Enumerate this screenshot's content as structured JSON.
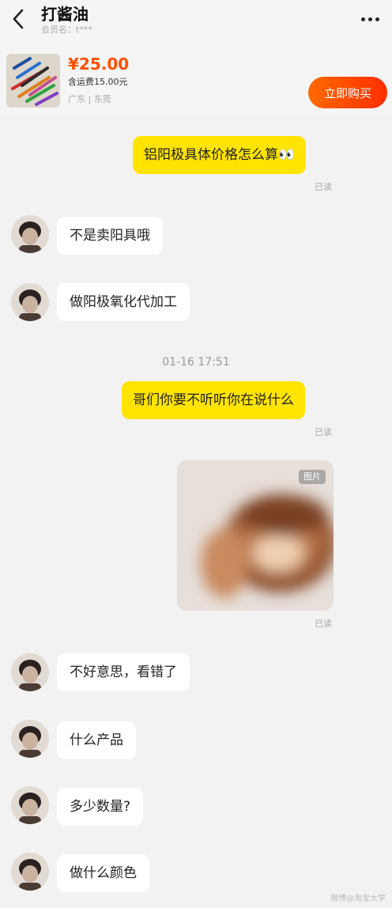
{
  "header": {
    "title": "打酱油",
    "subtitle": "会员名：t***"
  },
  "product": {
    "price": "¥25.00",
    "shipping": "含运费15.00元",
    "location": "广东 | 东莞",
    "buy_label": "立即购买"
  },
  "messages": {
    "m1": "铝阳极具体价格怎么算",
    "m1_emoji": "👀",
    "m1_status": "已读",
    "m2": "不是卖阳具哦",
    "m3": "做阳极氧化代加工",
    "timestamp": "01-16 17:51",
    "m4": "哥们你要不听听你在说什么",
    "m4_status": "已读",
    "photo_tag": "图片",
    "photo_status": "已读",
    "m5": "不好意思，看错了",
    "m6": "什么产品",
    "m7": "多少数量?",
    "m8": "做什么颜色"
  },
  "watermark": "微博@淘宝大学",
  "colors": {
    "accent_orange": "#ff5000",
    "own_bubble": "#ffe400",
    "other_bubble": "#ffffff",
    "background": "#f2f2f2"
  }
}
